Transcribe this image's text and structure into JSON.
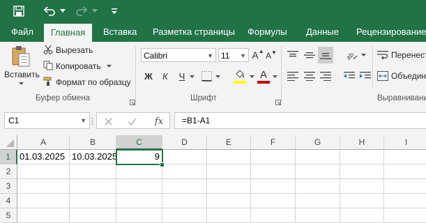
{
  "app": {
    "accent": "#217346",
    "ribbon_bg": "#f3f3f3"
  },
  "tabs": [
    {
      "label": "Файл",
      "active": false
    },
    {
      "label": "Главная",
      "active": true
    },
    {
      "label": "Вставка",
      "active": false
    },
    {
      "label": "Разметка страницы",
      "active": false
    },
    {
      "label": "Формулы",
      "active": false
    },
    {
      "label": "Данные",
      "active": false
    },
    {
      "label": "Рецензирование",
      "active": false
    }
  ],
  "clipboard": {
    "paste_label": "Вставить",
    "cut_label": "Вырезать",
    "copy_label": "Копировать",
    "format_painter_label": "Формат по образцу",
    "group_label": "Буфер обмена"
  },
  "font": {
    "font_name": "Calibri",
    "font_size": "11",
    "bold": "Ж",
    "italic": "К",
    "underline": "Ч",
    "grow": "A",
    "shrink": "A",
    "font_color_letter": "A",
    "group_label": "Шрифт",
    "highlight_color": "#ffff00",
    "font_color": "#c00000"
  },
  "alignment": {
    "wrap_label": "Перенести",
    "merge_label": "Объедини",
    "group_label": "Выравнивани"
  },
  "formula_bar": {
    "name_box": "C1",
    "fx_label": "fx",
    "formula": "=B1-A1"
  },
  "sheet": {
    "columns": [
      "A",
      "B",
      "C",
      "D",
      "E",
      "F",
      "G",
      "H",
      "I"
    ],
    "rows": [
      "1",
      "2",
      "3",
      "4",
      "5"
    ],
    "cells": {
      "A1": "01.03.2025",
      "B1": "10.03.2025",
      "C1": "9"
    },
    "selected_cell": "C1"
  }
}
